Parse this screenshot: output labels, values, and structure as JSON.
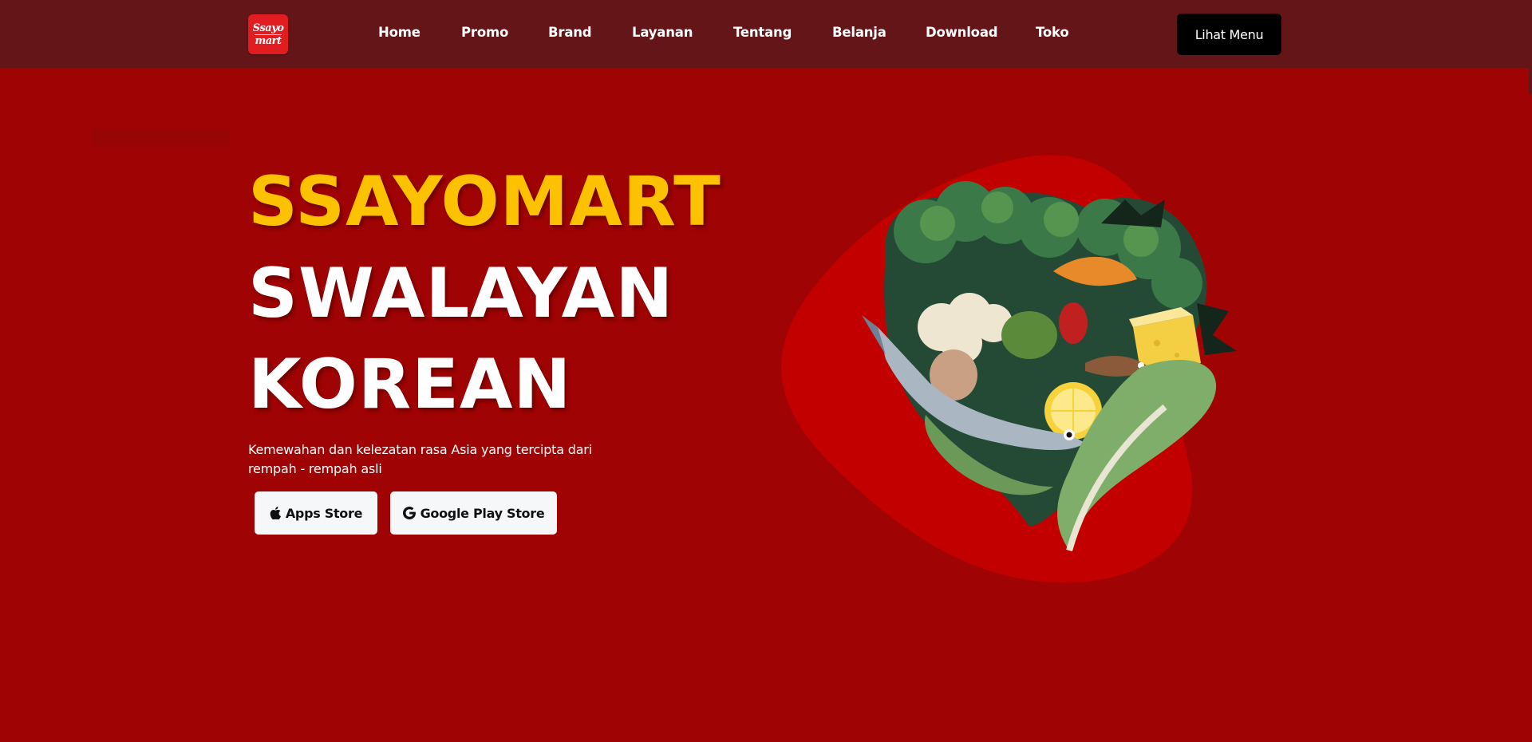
{
  "brand": {
    "logo_line1": "Ssayo",
    "logo_line2": "mart"
  },
  "nav": {
    "links": [
      "Home",
      "Promo",
      "Brand",
      "Layanan",
      "Tentang",
      "Belanja",
      "Download",
      "Toko"
    ],
    "menu_button": "Lihat Menu"
  },
  "hero": {
    "title_line1": "SSAYOMART",
    "title_line2": "SWALAYAN",
    "title_line3": "KOREAN",
    "description": "Kemewahan dan kelezatan rasa Asia yang tercipta dari rempah - rempah asli",
    "apps_store_label": "Apps Store",
    "google_play_label": "Google Play Store"
  },
  "colors": {
    "background": "#a00303",
    "navbar": "#641518",
    "accent_yellow": "#fcc200",
    "blob": "#c20000"
  },
  "icons": {
    "apps_store": "apple-icon",
    "google_play": "google-icon"
  }
}
